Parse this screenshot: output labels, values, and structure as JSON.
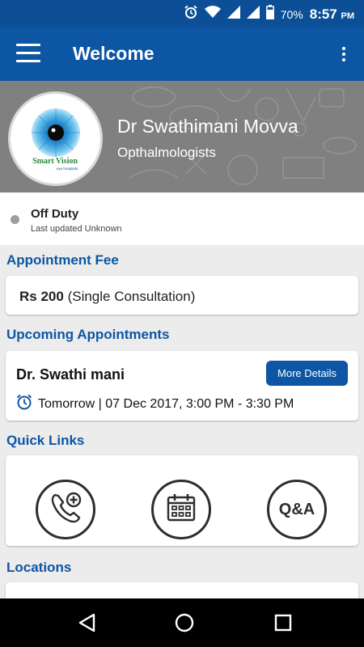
{
  "status_bar": {
    "battery_percent": "70%",
    "time": "8:57",
    "ampm": "PM",
    "icons": [
      "alarm-icon",
      "wifi-icon",
      "signal-icon",
      "signal-icon",
      "battery-icon"
    ]
  },
  "app_bar": {
    "title": "Welcome",
    "menu_icon": "hamburger-menu-icon",
    "overflow_icon": "more-vert-icon"
  },
  "profile": {
    "name": "Dr Swathimani Movva",
    "specialty": "Opthalmologists",
    "logo_text_main": "Smart Vision",
    "logo_text_sub": "eye hospitals"
  },
  "duty": {
    "status": "Off Duty",
    "last_updated": "Last updated Unknown",
    "dot_color": "#9e9e9e"
  },
  "appointment_fee": {
    "section_title": "Appointment Fee",
    "amount": "Rs 200",
    "description": "(Single Consultation)"
  },
  "upcoming": {
    "section_title": "Upcoming Appointments",
    "doctor": "Dr. Swathi mani",
    "button_label": "More Details",
    "time_text": "Tomorrow | 07 Dec 2017, 3:00 PM - 3:30 PM",
    "time_icon": "alarm-clock-icon"
  },
  "quick_links": {
    "section_title": "Quick Links",
    "items": [
      {
        "icon": "phone-plus-icon"
      },
      {
        "icon": "calendar-icon"
      },
      {
        "icon": "qa-icon",
        "label": "Q&A"
      }
    ]
  },
  "locations": {
    "section_title": "Locations"
  },
  "nav_bar": {
    "icons": [
      "back-icon",
      "home-icon",
      "recents-icon"
    ]
  },
  "colors": {
    "primary": "#0c56a4",
    "status_bar": "#0c4f96",
    "background": "#ececec"
  }
}
